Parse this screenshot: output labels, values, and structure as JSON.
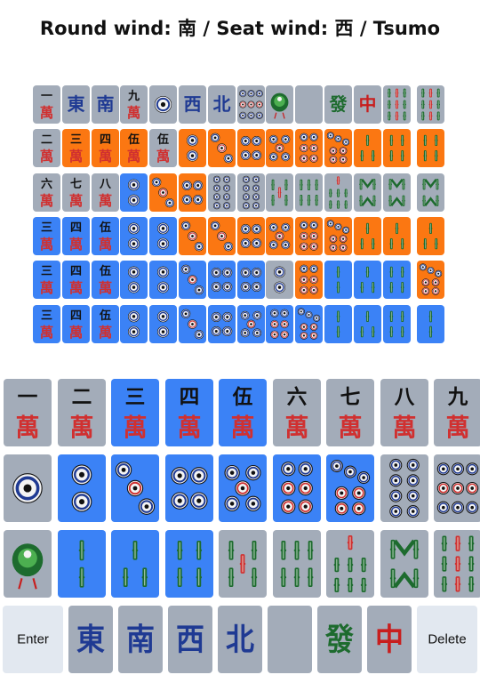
{
  "header": {
    "title": "Round wind: 南 / Seat wind: 西 / Tsumo"
  },
  "colors": {
    "gray": "#a3acb9",
    "orange": "#fb7712",
    "blue": "#3b82f6",
    "light": "#e2e8f0",
    "character_red": "#d03030",
    "numeral_black": "#111111",
    "honor_blue": "#1f3a93",
    "bamboo_green": "#1d6b2e",
    "dragon_red": "#c81e1e"
  },
  "guess_grid": {
    "rows": [
      {
        "tiles": [
          {
            "code": "1m",
            "bg": "gray"
          },
          {
            "code": "E",
            "bg": "gray"
          },
          {
            "code": "S",
            "bg": "gray"
          },
          {
            "code": "9m",
            "bg": "gray"
          },
          {
            "code": "1p",
            "bg": "gray"
          },
          {
            "code": "W",
            "bg": "gray"
          },
          {
            "code": "N",
            "bg": "gray"
          },
          {
            "code": "9p",
            "bg": "gray"
          },
          {
            "code": "1s",
            "bg": "gray"
          },
          {
            "code": "P",
            "bg": "gray"
          },
          {
            "code": "F",
            "bg": "gray"
          },
          {
            "code": "C",
            "bg": "gray"
          },
          {
            "code": "9s",
            "bg": "gray"
          },
          {
            "code": "9s",
            "bg": "gray"
          }
        ]
      },
      {
        "tiles": [
          {
            "code": "2m",
            "bg": "gray"
          },
          {
            "code": "3m",
            "bg": "orange"
          },
          {
            "code": "4m",
            "bg": "orange"
          },
          {
            "code": "5m",
            "bg": "orange"
          },
          {
            "code": "5m",
            "bg": "gray"
          },
          {
            "code": "2p",
            "bg": "orange"
          },
          {
            "code": "3p",
            "bg": "orange"
          },
          {
            "code": "4p",
            "bg": "orange"
          },
          {
            "code": "5p",
            "bg": "orange"
          },
          {
            "code": "6p",
            "bg": "orange"
          },
          {
            "code": "7p",
            "bg": "orange"
          },
          {
            "code": "3s",
            "bg": "orange"
          },
          {
            "code": "4s",
            "bg": "orange"
          },
          {
            "code": "4s",
            "bg": "orange"
          }
        ]
      },
      {
        "tiles": [
          {
            "code": "6m",
            "bg": "gray"
          },
          {
            "code": "7m",
            "bg": "gray"
          },
          {
            "code": "8m",
            "bg": "gray"
          },
          {
            "code": "2p",
            "bg": "blue"
          },
          {
            "code": "3p",
            "bg": "orange"
          },
          {
            "code": "4p",
            "bg": "orange"
          },
          {
            "code": "8p",
            "bg": "gray"
          },
          {
            "code": "8p",
            "bg": "gray"
          },
          {
            "code": "5s",
            "bg": "gray"
          },
          {
            "code": "6s",
            "bg": "gray"
          },
          {
            "code": "7s",
            "bg": "gray"
          },
          {
            "code": "8s",
            "bg": "gray"
          },
          {
            "code": "8s",
            "bg": "gray"
          },
          {
            "code": "8s",
            "bg": "gray"
          }
        ]
      },
      {
        "tiles": [
          {
            "code": "3m",
            "bg": "blue"
          },
          {
            "code": "4m",
            "bg": "blue"
          },
          {
            "code": "5m",
            "bg": "blue"
          },
          {
            "code": "2p",
            "bg": "blue"
          },
          {
            "code": "2p",
            "bg": "blue"
          },
          {
            "code": "3p",
            "bg": "orange"
          },
          {
            "code": "3p",
            "bg": "orange"
          },
          {
            "code": "4p",
            "bg": "orange"
          },
          {
            "code": "5p",
            "bg": "orange"
          },
          {
            "code": "6p",
            "bg": "orange"
          },
          {
            "code": "7p",
            "bg": "orange"
          },
          {
            "code": "3s",
            "bg": "orange"
          },
          {
            "code": "3s",
            "bg": "orange"
          },
          {
            "code": "3s",
            "bg": "orange"
          }
        ]
      },
      {
        "tiles": [
          {
            "code": "3m",
            "bg": "blue"
          },
          {
            "code": "4m",
            "bg": "blue"
          },
          {
            "code": "5m",
            "bg": "blue"
          },
          {
            "code": "2p",
            "bg": "blue"
          },
          {
            "code": "2p",
            "bg": "blue"
          },
          {
            "code": "3p",
            "bg": "blue"
          },
          {
            "code": "4p",
            "bg": "blue"
          },
          {
            "code": "4p",
            "bg": "blue"
          },
          {
            "code": "2p",
            "bg": "gray"
          },
          {
            "code": "6p",
            "bg": "orange"
          },
          {
            "code": "2s",
            "bg": "blue"
          },
          {
            "code": "3s",
            "bg": "blue"
          },
          {
            "code": "4s",
            "bg": "blue"
          },
          {
            "code": "7p",
            "bg": "orange"
          }
        ]
      },
      {
        "tiles": [
          {
            "code": "3m",
            "bg": "blue"
          },
          {
            "code": "4m",
            "bg": "blue"
          },
          {
            "code": "5m",
            "bg": "blue"
          },
          {
            "code": "2p",
            "bg": "blue"
          },
          {
            "code": "2p",
            "bg": "blue"
          },
          {
            "code": "3p",
            "bg": "blue"
          },
          {
            "code": "4p",
            "bg": "blue"
          },
          {
            "code": "5p",
            "bg": "blue"
          },
          {
            "code": "6p",
            "bg": "blue"
          },
          {
            "code": "7p",
            "bg": "blue"
          },
          {
            "code": "2s",
            "bg": "blue"
          },
          {
            "code": "3s",
            "bg": "blue"
          },
          {
            "code": "4s",
            "bg": "blue"
          },
          {
            "code": "2s",
            "bg": "blue"
          }
        ]
      }
    ]
  },
  "keyboard": {
    "rows": [
      {
        "keys": [
          {
            "code": "1m",
            "bg": "gray"
          },
          {
            "code": "2m",
            "bg": "gray"
          },
          {
            "code": "3m",
            "bg": "blue"
          },
          {
            "code": "4m",
            "bg": "blue"
          },
          {
            "code": "5m",
            "bg": "blue"
          },
          {
            "code": "6m",
            "bg": "gray"
          },
          {
            "code": "7m",
            "bg": "gray"
          },
          {
            "code": "8m",
            "bg": "gray"
          },
          {
            "code": "9m",
            "bg": "gray"
          }
        ]
      },
      {
        "keys": [
          {
            "code": "1p",
            "bg": "gray"
          },
          {
            "code": "2p",
            "bg": "blue"
          },
          {
            "code": "3p",
            "bg": "blue"
          },
          {
            "code": "4p",
            "bg": "blue"
          },
          {
            "code": "5p",
            "bg": "blue"
          },
          {
            "code": "6p",
            "bg": "blue"
          },
          {
            "code": "7p",
            "bg": "blue"
          },
          {
            "code": "8p",
            "bg": "gray"
          },
          {
            "code": "9p",
            "bg": "gray"
          }
        ]
      },
      {
        "keys": [
          {
            "code": "1s",
            "bg": "gray"
          },
          {
            "code": "2s",
            "bg": "blue"
          },
          {
            "code": "3s",
            "bg": "blue"
          },
          {
            "code": "4s",
            "bg": "blue"
          },
          {
            "code": "5s",
            "bg": "gray"
          },
          {
            "code": "6s",
            "bg": "gray"
          },
          {
            "code": "7s",
            "bg": "gray"
          },
          {
            "code": "8s",
            "bg": "gray"
          },
          {
            "code": "9s",
            "bg": "gray"
          }
        ]
      },
      {
        "keys": [
          {
            "code": "ENTER",
            "bg": "light",
            "label": "Enter"
          },
          {
            "code": "E",
            "bg": "gray"
          },
          {
            "code": "S",
            "bg": "gray"
          },
          {
            "code": "W",
            "bg": "gray"
          },
          {
            "code": "N",
            "bg": "gray"
          },
          {
            "code": "P",
            "bg": "gray"
          },
          {
            "code": "F",
            "bg": "gray"
          },
          {
            "code": "C",
            "bg": "gray"
          },
          {
            "code": "DELETE",
            "bg": "light",
            "label": "Delete"
          }
        ]
      }
    ]
  },
  "glyphs": {
    "manzu_numerals": [
      "一",
      "二",
      "三",
      "四",
      "伍",
      "六",
      "七",
      "八",
      "九"
    ],
    "manzu_suffix": "萬",
    "honors": {
      "E": "東",
      "S": "南",
      "W": "西",
      "N": "北",
      "F": "發",
      "C": "中"
    }
  }
}
